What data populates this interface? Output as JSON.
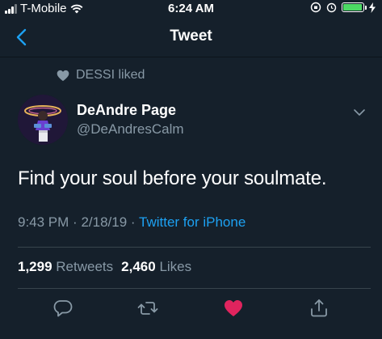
{
  "status_bar": {
    "carrier": "T-Mobile",
    "time": "6:24 AM",
    "battery_level": 0.95
  },
  "nav": {
    "title": "Tweet",
    "back_icon": "chevron-left-icon"
  },
  "social_context": {
    "text": "DESSI liked",
    "icon": "heart-icon"
  },
  "author": {
    "name": "DeAndre Page",
    "handle": "@DeAndresCalm"
  },
  "tweet": {
    "text": "Find your soul before your soulmate.",
    "time": "9:43 PM",
    "date": "2/18/19",
    "separator": "·",
    "source": "Twitter for iPhone"
  },
  "counts": {
    "retweets_num": "1,299",
    "retweets_label": "Retweets",
    "likes_num": "2,460",
    "likes_label": "Likes"
  },
  "actions": {
    "reply_icon": "reply-icon",
    "retweet_icon": "retweet-icon",
    "like_icon": "heart-filled-icon",
    "share_icon": "share-icon"
  },
  "colors": {
    "background": "#15202b",
    "accent": "#1da1f2",
    "secondary_text": "#8899a6",
    "like": "#e0245e",
    "battery": "#4cd964"
  }
}
